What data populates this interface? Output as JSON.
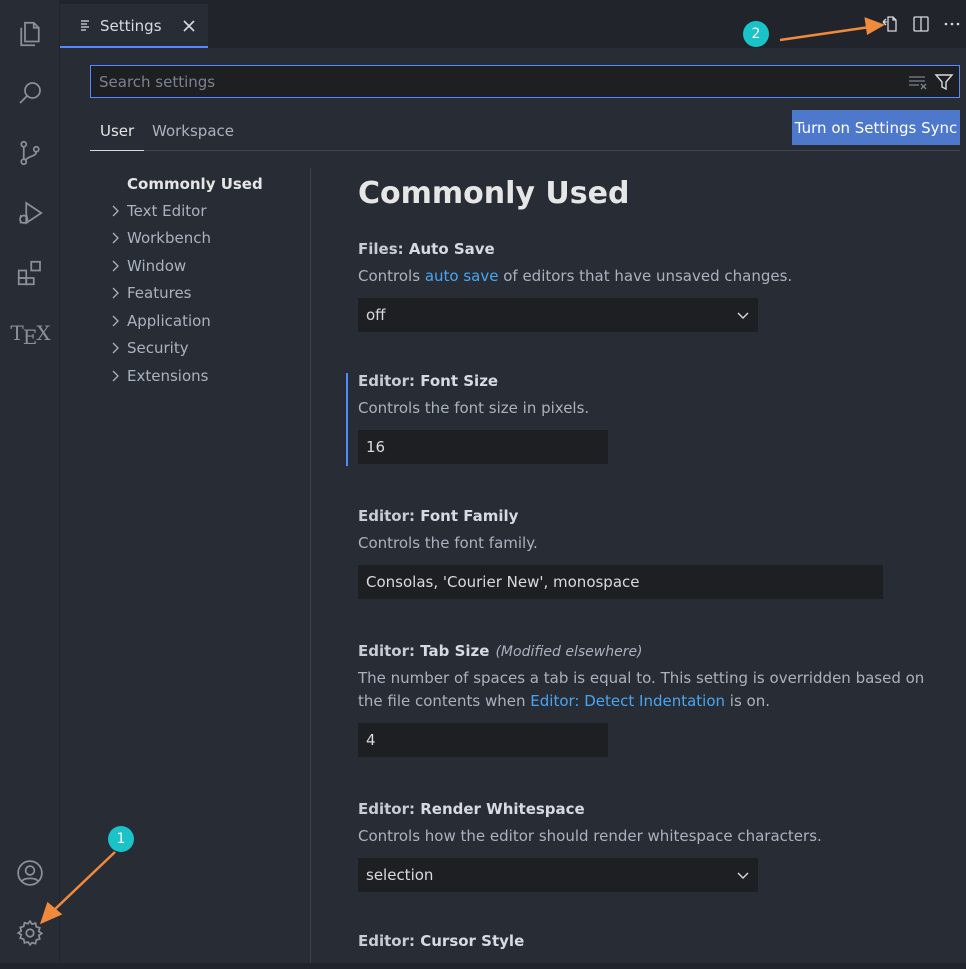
{
  "tab": {
    "label": "Settings"
  },
  "search": {
    "placeholder": "Search settings"
  },
  "scope_tabs": [
    {
      "label": "User"
    },
    {
      "label": "Workspace"
    }
  ],
  "sync_button": "Turn on Settings Sync",
  "toc": {
    "items": [
      {
        "label": "Commonly Used"
      },
      {
        "label": "Text Editor"
      },
      {
        "label": "Workbench"
      },
      {
        "label": "Window"
      },
      {
        "label": "Features"
      },
      {
        "label": "Application"
      },
      {
        "label": "Security"
      },
      {
        "label": "Extensions"
      }
    ]
  },
  "section_title": "Commonly Used",
  "settings": {
    "auto_save": {
      "category": "Files: ",
      "name": "Auto Save",
      "desc_pre": "Controls ",
      "desc_link": "auto save",
      "desc_post": " of editors that have unsaved changes.",
      "value": "off"
    },
    "font_size": {
      "category": "Editor: ",
      "name": "Font Size",
      "desc": "Controls the font size in pixels.",
      "value": "16"
    },
    "font_family": {
      "category": "Editor: ",
      "name": "Font Family",
      "desc": "Controls the font family.",
      "value": "Consolas, 'Courier New', monospace"
    },
    "tab_size": {
      "category": "Editor: ",
      "name": "Tab Size",
      "modified": "(Modified elsewhere)",
      "desc_pre": "The number of spaces a tab is equal to. This setting is overridden based on the file contents when ",
      "desc_link": "Editor: Detect Indentation",
      "desc_post": " is on.",
      "value": "4"
    },
    "render_whitespace": {
      "category": "Editor: ",
      "name": "Render Whitespace",
      "desc": "Controls how the editor should render whitespace characters.",
      "value": "selection"
    },
    "cursor_style": {
      "category": "Editor: ",
      "name": "Cursor Style"
    }
  },
  "annotations": [
    {
      "label": "1"
    },
    {
      "label": "2"
    }
  ],
  "colors": {
    "accent": "#528bff",
    "annotation": "#19c3c8",
    "arrow": "#f08a3c",
    "sync_button": "#4d78cc",
    "link": "#4aa5f0"
  }
}
